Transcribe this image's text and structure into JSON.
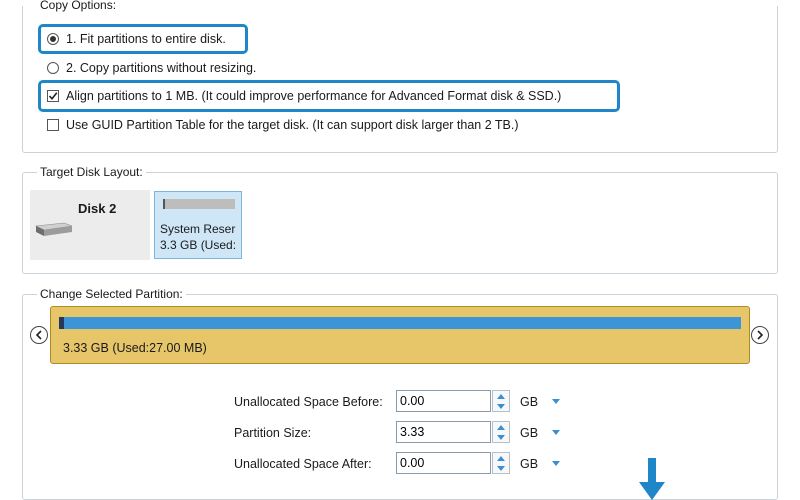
{
  "copy_options": {
    "title": "Copy Options:",
    "fit_label": "1. Fit partitions to entire disk.",
    "fit_selected": true,
    "copy_label": "2. Copy partitions without resizing.",
    "copy_selected": false,
    "align_label": "Align partitions to 1 MB.  (It could improve performance for Advanced Format disk & SSD.)",
    "align_checked": true,
    "gpt_label": "Use GUID Partition Table for the target disk. (It can support disk larger than 2 TB.)",
    "gpt_checked": false
  },
  "target_layout": {
    "title": "Target Disk Layout:",
    "disk_name": "Disk 2",
    "partition_name": "System Reser",
    "partition_size": "3.3 GB (Used:"
  },
  "change_partition": {
    "title": "Change Selected Partition:",
    "bar_label": "3.33 GB (Used:27.00 MB)",
    "used_fraction": 0.008,
    "fields": [
      {
        "label": "Unallocated Space Before:",
        "value": "0.00",
        "unit": "GB"
      },
      {
        "label": "Partition Size:",
        "value": "3.33",
        "unit": "GB"
      },
      {
        "label": "Unallocated Space After:",
        "value": "0.00",
        "unit": "GB"
      }
    ]
  },
  "colors": {
    "highlight": "#1f86c8",
    "bar_fill": "#3b95d6",
    "bar_background": "#e7c66a",
    "arrow": "#1f86c8"
  }
}
